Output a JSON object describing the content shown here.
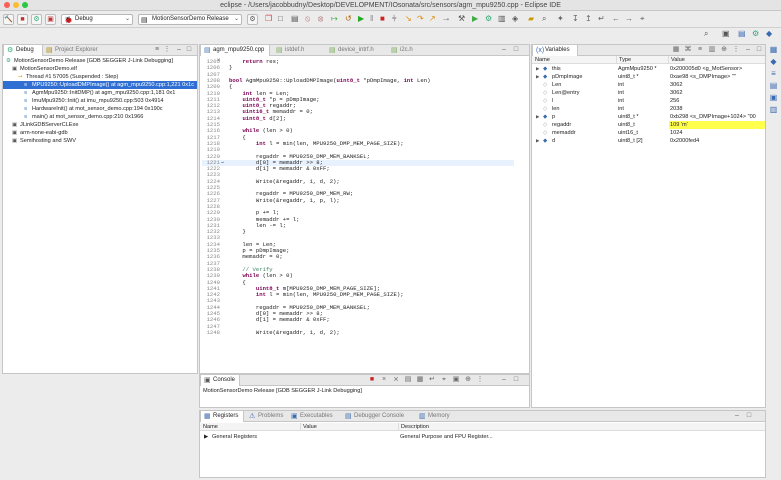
{
  "window": {
    "title": "eclipse - /Users/jacobbudny/Desktop/DEVELOPMENT/IOsonata/src/sensors/agm_mpu9250.cpp - Eclipse IDE"
  },
  "toolbar": {
    "launch_mode": "Debug",
    "launch_config": "MotionSensorDemo Release"
  },
  "debug_view": {
    "tabs": [
      {
        "label": "Debug",
        "icon": "debug-icon"
      },
      {
        "label": "Project Explorer",
        "icon": "project-explorer-icon"
      }
    ],
    "rows": [
      {
        "text": "MotionSensorDemo Release [GDB SEGGER J-Link Debugging]",
        "indent": 0,
        "icon": "launch-icon"
      },
      {
        "text": "MotionSensorDemo.elf",
        "indent": 1,
        "icon": "process-icon"
      },
      {
        "text": "Thread #1 57005 (Suspended : Step)",
        "indent": 2,
        "icon": "thread-icon"
      },
      {
        "text": "MPU9250::UploadDMPImage() at agm_mpu9250.cpp:1,221 0x1c",
        "indent": 3,
        "icon": "stack-frame-icon",
        "selected": true
      },
      {
        "text": "AgmMpu9250::InitDMP() at agm_mpu9250.cpp:1,181 0x1",
        "indent": 3,
        "icon": "stack-frame-icon"
      },
      {
        "text": "ImuMpu9250::Init() at imu_mpu9250.cpp:503 0x4914",
        "indent": 3,
        "icon": "stack-frame-icon"
      },
      {
        "text": "HardwareInit() at mot_sensor_demo.cpp:194 0x190c",
        "indent": 3,
        "icon": "stack-frame-icon"
      },
      {
        "text": "main() at mot_sensor_demo.cpp:210 0x1966",
        "indent": 3,
        "icon": "stack-frame-icon"
      },
      {
        "text": "JLinkGDBServerCLExe",
        "indent": 1,
        "icon": "process-icon"
      },
      {
        "text": "arm-none-eabi-gdb",
        "indent": 1,
        "icon": "process-icon"
      },
      {
        "text": "Semihosting and SWV",
        "indent": 1,
        "icon": "process-icon"
      }
    ]
  },
  "editor": {
    "tabs": [
      "agm_mpu9250.cpp",
      "istdef.h",
      "device_intrf.h",
      "i2c.h"
    ],
    "current_line": "1221",
    "lines": [
      {
        "n": "1205",
        "t": "    return res;"
      },
      {
        "n": "1206",
        "t": "}"
      },
      {
        "n": "1207",
        "t": ""
      },
      {
        "n": "1208",
        "t": "bool AgmMpu9250::UploadDMPImage(uint8_t *pDmpImage, int Len)"
      },
      {
        "n": "1209",
        "t": "{"
      },
      {
        "n": "1210",
        "t": "    int len = Len;"
      },
      {
        "n": "1211",
        "t": "    uint8_t *p = pDmpImage;"
      },
      {
        "n": "1212",
        "t": "    uint8_t regaddr;"
      },
      {
        "n": "1213",
        "t": "    uint16_t memaddr = 0;"
      },
      {
        "n": "1214",
        "t": "    uint8_t d[2];"
      },
      {
        "n": "1215",
        "t": ""
      },
      {
        "n": "1216",
        "t": "    while (len > 0)"
      },
      {
        "n": "1217",
        "t": "    {"
      },
      {
        "n": "1218",
        "t": "        int l = min(len, MPU9250_DMP_MEM_PAGE_SIZE);"
      },
      {
        "n": "1219",
        "t": ""
      },
      {
        "n": "1220",
        "t": "        regaddr = MPU9250_DMP_MEM_BANKSEL;"
      },
      {
        "n": "1221",
        "t": "        d[0] = memaddr >> 8;"
      },
      {
        "n": "1222",
        "t": "        d[1] = memaddr & 0xFF;"
      },
      {
        "n": "1223",
        "t": ""
      },
      {
        "n": "1224",
        "t": "        Write(&regaddr, 1, d, 2);"
      },
      {
        "n": "1225",
        "t": ""
      },
      {
        "n": "1226",
        "t": "        regaddr = MPU9250_DMP_MEM_RW;"
      },
      {
        "n": "1227",
        "t": "        Write(&regaddr, 1, p, l);"
      },
      {
        "n": "1228",
        "t": ""
      },
      {
        "n": "1229",
        "t": "        p += l;"
      },
      {
        "n": "1230",
        "t": "        memaddr += l;"
      },
      {
        "n": "1231",
        "t": "        len -= l;"
      },
      {
        "n": "1232",
        "t": "    }"
      },
      {
        "n": "1233",
        "t": ""
      },
      {
        "n": "1234",
        "t": "    len = Len;"
      },
      {
        "n": "1235",
        "t": "    p = pDmpImage;"
      },
      {
        "n": "1236",
        "t": "    memaddr = 0;"
      },
      {
        "n": "1237",
        "t": ""
      },
      {
        "n": "1238",
        "t": "    // Verify"
      },
      {
        "n": "1239",
        "t": "    while (len > 0)"
      },
      {
        "n": "1240",
        "t": "    {"
      },
      {
        "n": "1241",
        "t": "        uint8_t m[MPU9250_DMP_MEM_PAGE_SIZE];"
      },
      {
        "n": "1242",
        "t": "        int l = min(len, MPU9250_DMP_MEM_PAGE_SIZE);"
      },
      {
        "n": "1243",
        "t": ""
      },
      {
        "n": "1244",
        "t": "        regaddr = MPU9250_DMP_MEM_BANKSEL;"
      },
      {
        "n": "1245",
        "t": "        d[0] = memaddr >> 8;"
      },
      {
        "n": "1246",
        "t": "        d[1] = memaddr & 0xFF;"
      },
      {
        "n": "1247",
        "t": ""
      },
      {
        "n": "1248",
        "t": "        Write(&regaddr, 1, d, 2);"
      }
    ]
  },
  "variables": {
    "tab": "Variables",
    "columns": [
      "Name",
      "Type",
      "Value"
    ],
    "rows": [
      {
        "name": "this",
        "type": "AgmMpu9250 *",
        "value": "0x200005d0 <g_MotSensor>",
        "icon": "pointer-icon",
        "expand": true
      },
      {
        "name": "pDmpImage",
        "type": "uint8_t *",
        "value": "0xae98 <s_DMPImage> \"\"",
        "icon": "pointer-icon",
        "expand": true
      },
      {
        "name": "Len",
        "type": "int",
        "value": "3062",
        "icon": "variable-icon"
      },
      {
        "name": "Len@entry",
        "type": "int",
        "value": "3062",
        "icon": "variable-icon"
      },
      {
        "name": "l",
        "type": "int",
        "value": "256",
        "icon": "variable-icon"
      },
      {
        "name": "len",
        "type": "int",
        "value": "2038",
        "icon": "variable-icon"
      },
      {
        "name": "p",
        "type": "uint8_t *",
        "value": "0xb298 <s_DMPImage+1024> \"00",
        "icon": "pointer-icon",
        "expand": true
      },
      {
        "name": "regaddr",
        "type": "uint8_t",
        "value": "109 'm'",
        "icon": "variable-icon",
        "highlight": true
      },
      {
        "name": "memaddr",
        "type": "uint16_t",
        "value": "1024",
        "icon": "variable-icon"
      },
      {
        "name": "d",
        "type": "uint8_t [2]",
        "value": "0x2000fed4",
        "icon": "array-icon",
        "expand": true
      }
    ]
  },
  "console": {
    "tab": "Console",
    "text": "MotionSensorDemo Release [GDB SEGGER J-Link Debugging]"
  },
  "bottom_panel": {
    "tabs": [
      "Registers",
      "Problems",
      "Executables",
      "Debugger Console",
      "Memory"
    ],
    "columns": [
      "Name",
      "Value",
      "Description"
    ],
    "rows": [
      {
        "name": "General Registers",
        "value": "",
        "description": "General Purpose and FPU Register..."
      }
    ]
  },
  "colors": {
    "accent": "#2f6fd3",
    "highlight": "#ffff4c",
    "keyword": "#7f0055",
    "comment": "#3f7f5f"
  }
}
